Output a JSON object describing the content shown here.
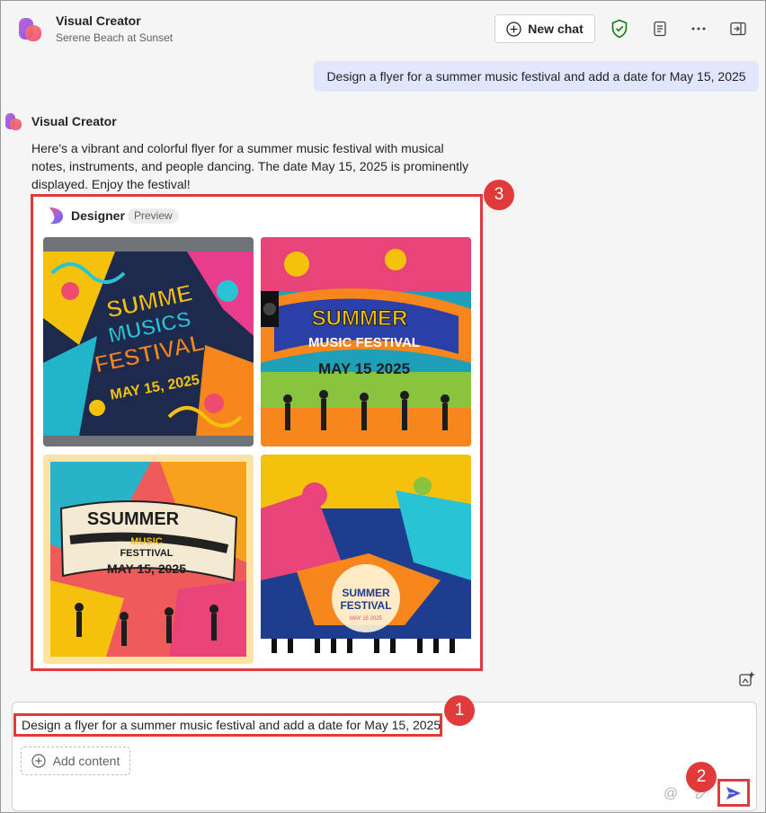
{
  "header": {
    "title": "Visual Creator",
    "subtitle": "Serene Beach at Sunset",
    "new_chat_label": "New chat",
    "icons": [
      "shield-check-icon",
      "notes-icon",
      "more-icon",
      "sidebar-icon"
    ]
  },
  "conversation": {
    "user_message": "Design a flyer for a summer music festival and add a date for May 15, 2025",
    "bot_name": "Visual Creator",
    "bot_reply": "Here's a vibrant and colorful flyer for a summer music festival with musical notes, instruments, and people dancing. The date May 15, 2025 is prominently displayed. Enjoy the festival!",
    "designer": {
      "name": "Designer",
      "badge": "Preview",
      "images": [
        {
          "line1": "SUMME",
          "line2": "MUSICS",
          "line3": "FESTIVAL",
          "date": "MAY 15, 2025"
        },
        {
          "line1": "SUMMER",
          "line2": "MUSIC FESTIVAL",
          "date": "MAY 15 2025"
        },
        {
          "line1": "SSUMMER",
          "line2": "MUSIC",
          "line3": "FESTTIVAL",
          "date": "MAY 15, 2025"
        },
        {
          "line1": "SUMMER",
          "line2": "FESTIVAL",
          "date": "MAY 15 2025"
        }
      ]
    }
  },
  "compose": {
    "value": "Design a flyer for a summer music festival and add a date for May 15, 2025",
    "add_content_label": "Add content",
    "at_symbol": "@"
  },
  "annotations": {
    "badge1": "1",
    "badge2": "2",
    "badge3": "3"
  },
  "colors": {
    "accent": "#e03a3a",
    "user_bubble": "#e0e6fb",
    "send": "#4f52d8"
  }
}
